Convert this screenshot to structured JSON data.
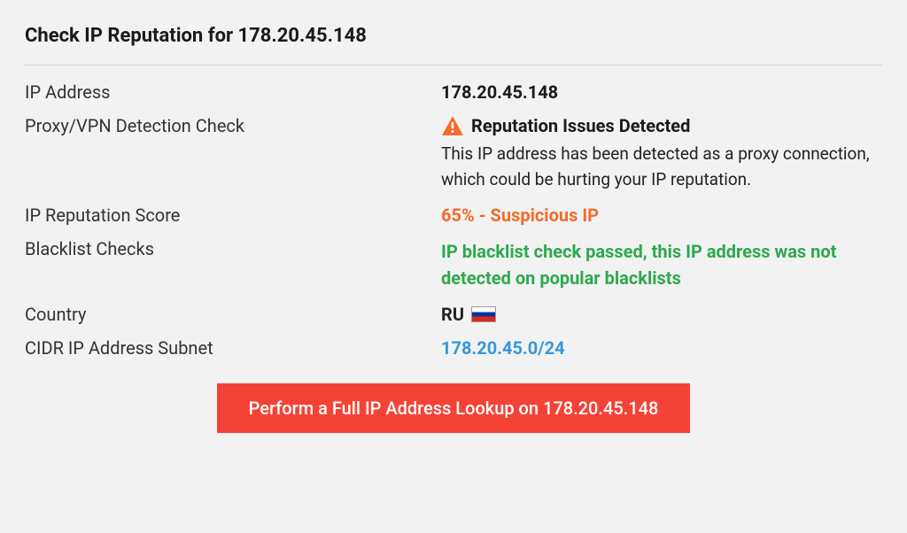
{
  "title": "Check IP Reputation for 178.20.45.148",
  "rows": {
    "ip_address": {
      "label": "IP Address",
      "value": "178.20.45.148"
    },
    "proxy": {
      "label": "Proxy/VPN Detection Check",
      "title": "Reputation Issues Detected",
      "description": "This IP address has been detected as a proxy connection, which could be hurting your IP reputation."
    },
    "score": {
      "label": "IP Reputation Score",
      "value": "65% - Suspicious IP"
    },
    "blacklist": {
      "label": "Blacklist Checks",
      "value": "IP blacklist check passed, this IP address was not detected on popular blacklists"
    },
    "country": {
      "label": "Country",
      "value": "RU"
    },
    "cidr": {
      "label": "CIDR IP Address Subnet",
      "value": "178.20.45.0/24"
    }
  },
  "button": {
    "label": "Perform a Full IP Address Lookup on 178.20.45.148"
  }
}
